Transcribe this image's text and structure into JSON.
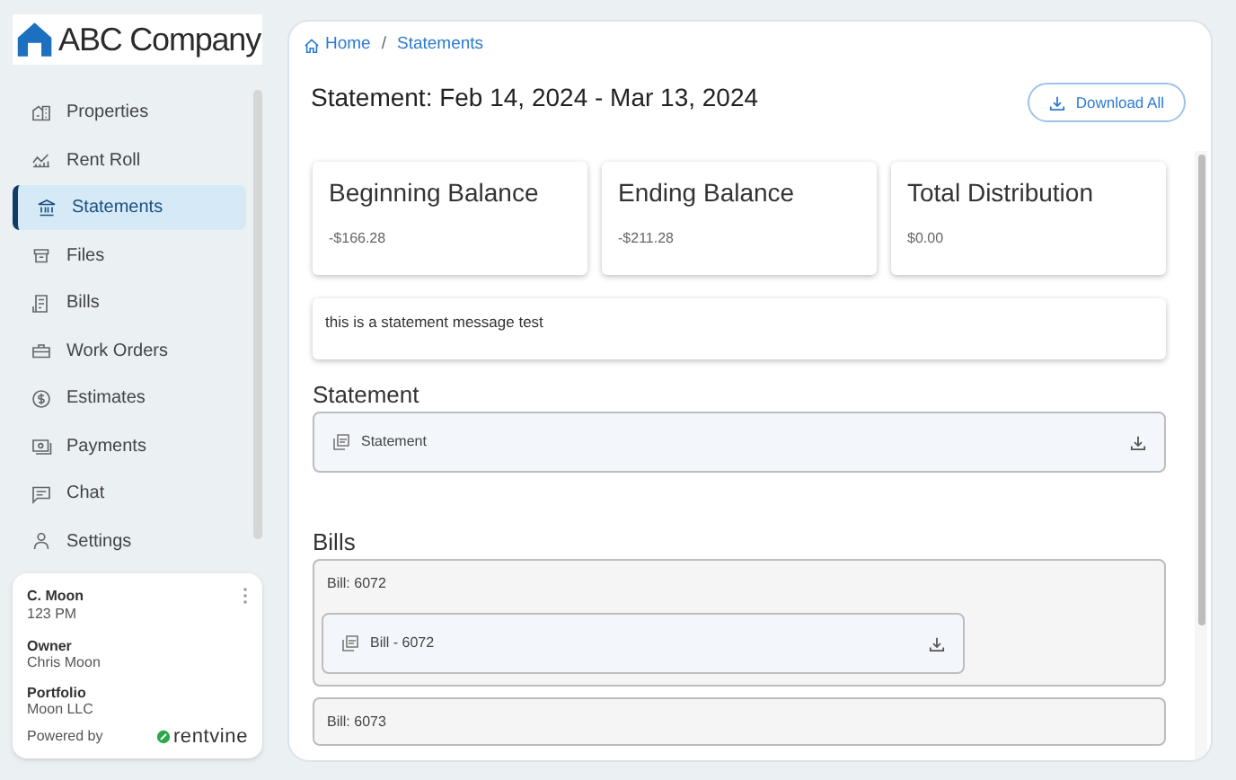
{
  "logo": {
    "text": "ABC Company"
  },
  "nav": [
    {
      "label": "Properties",
      "selected": false
    },
    {
      "label": "Rent Roll",
      "selected": false
    },
    {
      "label": "Statements",
      "selected": true
    },
    {
      "label": "Files",
      "selected": false
    },
    {
      "label": "Bills",
      "selected": false
    },
    {
      "label": "Work Orders",
      "selected": false
    },
    {
      "label": "Estimates",
      "selected": false
    },
    {
      "label": "Payments",
      "selected": false
    },
    {
      "label": "Chat",
      "selected": false
    },
    {
      "label": "Settings",
      "selected": false
    }
  ],
  "user_card": {
    "name": "C. Moon",
    "unit": "123 PM",
    "fields": [
      {
        "label": "Owner",
        "value": "Chris Moon"
      },
      {
        "label": "Portfolio",
        "value": "Moon LLC"
      }
    ],
    "powered_by": "Powered by",
    "brand": "rentvine"
  },
  "breadcrumb": {
    "items": [
      "Home",
      "Statements"
    ],
    "separator": "/"
  },
  "title": "Statement: Feb 14, 2024 - Mar 13, 2024",
  "download_all": "Download All",
  "summary": [
    {
      "label": "Beginning Balance",
      "value": "-$166.28"
    },
    {
      "label": "Ending Balance",
      "value": "-$211.28"
    },
    {
      "label": "Total Distribution",
      "value": "$0.00"
    }
  ],
  "message": "this is a statement message test",
  "statement_section": {
    "heading": "Statement",
    "files": [
      {
        "name": "Statement"
      }
    ]
  },
  "bills_section": {
    "heading": "Bills",
    "bills": [
      {
        "title": "Bill: 6072",
        "files": [
          {
            "name": "Bill - 6072"
          }
        ]
      },
      {
        "title": "Bill: 6073"
      }
    ]
  }
}
